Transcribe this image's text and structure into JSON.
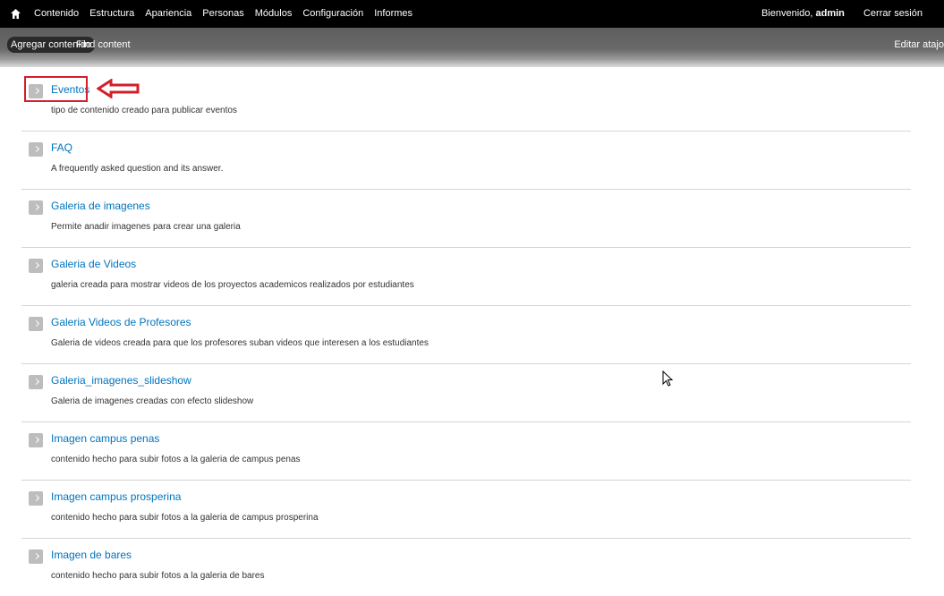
{
  "toolbar": {
    "menu": [
      "Contenido",
      "Estructura",
      "Apariencia",
      "Personas",
      "Módulos",
      "Configuración",
      "Informes"
    ],
    "welcome_prefix": "Bienvenido,",
    "username": "admin",
    "logout": "Cerrar sesión"
  },
  "shortcuts": {
    "active": "Agregar contenido",
    "find": "Find content",
    "edit": "Editar atajo"
  },
  "content_types": [
    {
      "title": "Eventos",
      "description": "tipo de contenido creado para publicar eventos"
    },
    {
      "title": "FAQ",
      "description": "A frequently asked question and its answer."
    },
    {
      "title": "Galeria de imagenes",
      "description": "Permite anadir imagenes para crear una galeria"
    },
    {
      "title": "Galeria de Videos",
      "description": "galeria creada para mostrar videos de los proyectos academicos realizados por estudiantes"
    },
    {
      "title": "Galeria Videos de Profesores",
      "description": "Galeria de videos creada para que los profesores suban videos que interesen a los estudiantes"
    },
    {
      "title": "Galeria_imagenes_slideshow",
      "description": "Galeria de imagenes creadas con efecto slideshow"
    },
    {
      "title": "Imagen campus penas",
      "description": "contenido hecho para subir fotos a la galeria de campus penas"
    },
    {
      "title": "Imagen campus prosperina",
      "description": "contenido hecho para subir fotos a la galeria de campus prosperina"
    },
    {
      "title": "Imagen de bares",
      "description": "contenido hecho para subir fotos a la galeria de bares"
    }
  ],
  "colors": {
    "toolbar_bg": "#000000",
    "link": "#0074bd",
    "highlight": "#d21f2a"
  }
}
